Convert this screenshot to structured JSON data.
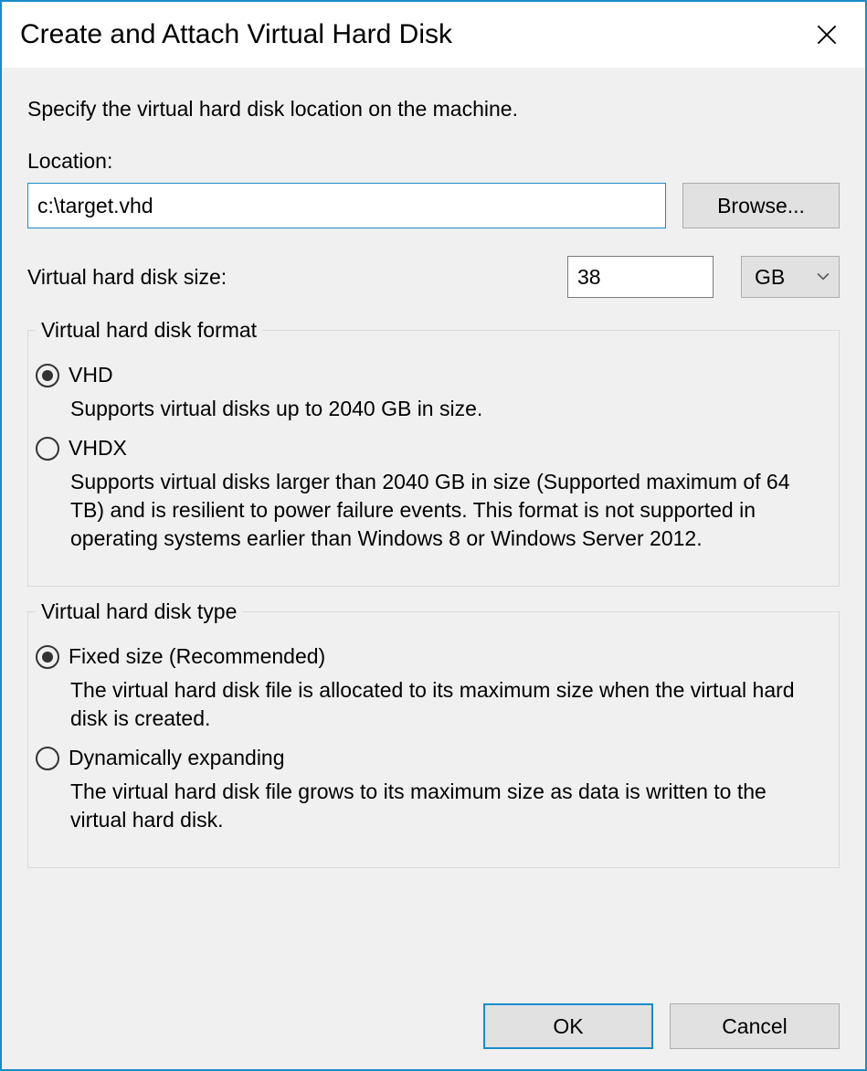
{
  "title": "Create and Attach Virtual Hard Disk",
  "instruction": "Specify the virtual hard disk location on the machine.",
  "location": {
    "label": "Location:",
    "value": "c:\\target.vhd",
    "browse_label": "Browse..."
  },
  "size": {
    "label": "Virtual hard disk size:",
    "value": "38",
    "unit": "GB"
  },
  "format_group": {
    "legend": "Virtual hard disk format",
    "options": [
      {
        "label": "VHD",
        "selected": true,
        "description": "Supports virtual disks up to 2040 GB in size."
      },
      {
        "label": "VHDX",
        "selected": false,
        "description": "Supports virtual disks larger than 2040 GB in size (Supported maximum of 64 TB) and is resilient to power failure events. This format is not supported in operating systems earlier than Windows 8 or Windows Server 2012."
      }
    ]
  },
  "type_group": {
    "legend": "Virtual hard disk type",
    "options": [
      {
        "label": "Fixed size (Recommended)",
        "selected": true,
        "description": "The virtual hard disk file is allocated to its maximum size when the virtual hard disk is created."
      },
      {
        "label": "Dynamically expanding",
        "selected": false,
        "description": "The virtual hard disk file grows to its maximum size as data is written to the virtual hard disk."
      }
    ]
  },
  "buttons": {
    "ok": "OK",
    "cancel": "Cancel"
  }
}
